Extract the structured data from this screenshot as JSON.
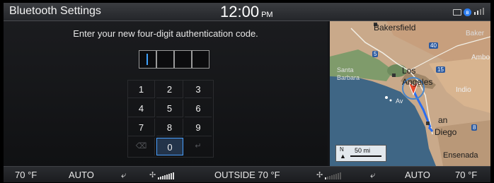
{
  "header": {
    "title": "Bluetooth Settings",
    "time": "12:00",
    "ampm": "PM"
  },
  "auth": {
    "prompt": "Enter your new four-digit authentication code.",
    "code_digits": [
      "",
      "",
      "",
      ""
    ]
  },
  "keypad": {
    "keys": [
      "1",
      "2",
      "3",
      "4",
      "5",
      "6",
      "7",
      "8",
      "9"
    ],
    "zero": "0",
    "backspace_symbol": "⌫",
    "enter_symbol": "↵"
  },
  "map": {
    "labels": {
      "bakersfield": "Bakersfield",
      "baker": "Baker",
      "los": "Los",
      "angeles": "Angeles",
      "santa": "Santa",
      "barbara": "Barbara",
      "amboy": "Ambo",
      "indio": "Indio",
      "san": "an",
      "diego": "Diego",
      "ensenada": "Ensenada",
      "av": "Av"
    },
    "shields": [
      "5",
      "40",
      "15",
      "8"
    ],
    "scale_label": "50 mi",
    "north": "N"
  },
  "climate": {
    "left_temp": "70 °F",
    "left_mode": "AUTO",
    "outside": "OUTSIDE  70 °F",
    "right_temp": "70 °F",
    "right_mode": "AUTO"
  },
  "colors": {
    "accent": "#3fa3ff",
    "route": "#2a6df0",
    "nav_arrow": "#e8472a"
  }
}
